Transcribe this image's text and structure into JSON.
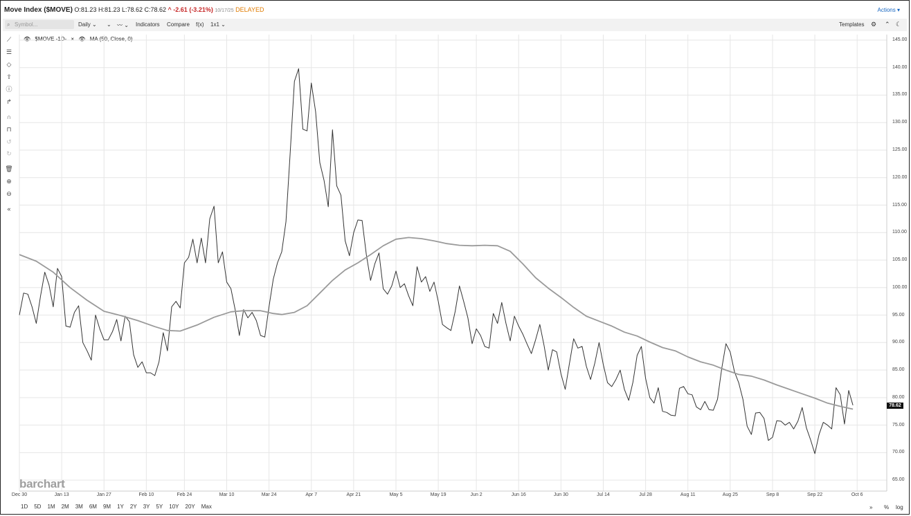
{
  "header": {
    "title": "Move Index ($MOVE)",
    "ohlc": "O:81.23 H:81.23 L:78.62 C:78.62",
    "change": "^ -2.61 (-3.21%)",
    "date": "10/17/25",
    "status": "DELAYED",
    "actions_label": "Actions"
  },
  "toolbar": {
    "symbol_placeholder": "Symbol...",
    "period": "Daily",
    "indicators": "Indicators",
    "compare": "Compare",
    "fx": "f(x)",
    "layout": "1x1",
    "templates": "Templates"
  },
  "legend": {
    "series": "$MOVE -1D-",
    "ma": "MA (50, Close, 0)"
  },
  "watermark": "barchart",
  "last_price_label": "78.62",
  "range_buttons": [
    "1D",
    "5D",
    "1M",
    "2M",
    "3M",
    "6M",
    "9M",
    "1Y",
    "2Y",
    "3Y",
    "5Y",
    "10Y",
    "20Y",
    "Max"
  ],
  "bottom_right": {
    "percent": "%",
    "log": "log"
  },
  "colors": {
    "price": "#333333",
    "ma": "#9a9a9a",
    "negative": "#c62828",
    "delayed": "#e07b00",
    "link": "#1565c0"
  },
  "chart_data": {
    "type": "line",
    "ylim": [
      63,
      146
    ],
    "yticks": [
      "145.00",
      "140.00",
      "135.00",
      "130.00",
      "125.00",
      "120.00",
      "115.00",
      "110.00",
      "105.00",
      "100.00",
      "95.00",
      "90.00",
      "85.00",
      "80.00",
      "75.00",
      "70.00",
      "65.00"
    ],
    "x_range": [
      0,
      205
    ],
    "xticks": [
      {
        "label": "Dec 30",
        "x": 0
      },
      {
        "label": "Jan 13",
        "x": 10
      },
      {
        "label": "Jan 27",
        "x": 20
      },
      {
        "label": "Feb 10",
        "x": 30
      },
      {
        "label": "Feb 24",
        "x": 39
      },
      {
        "label": "Mar 10",
        "x": 49
      },
      {
        "label": "Mar 24",
        "x": 59
      },
      {
        "label": "Apr 7",
        "x": 69
      },
      {
        "label": "Apr 21",
        "x": 79
      },
      {
        "label": "May 5",
        "x": 89
      },
      {
        "label": "May 19",
        "x": 99
      },
      {
        "label": "Jun 2",
        "x": 108
      },
      {
        "label": "Jun 16",
        "x": 118
      },
      {
        "label": "Jun 30",
        "x": 128
      },
      {
        "label": "Jul 14",
        "x": 138
      },
      {
        "label": "Jul 28",
        "x": 148
      },
      {
        "label": "Aug 11",
        "x": 158
      },
      {
        "label": "Aug 25",
        "x": 168
      },
      {
        "label": "Sep 8",
        "x": 178
      },
      {
        "label": "Sep 22",
        "x": 188
      },
      {
        "label": "Oct 6",
        "x": 198
      }
    ],
    "series": [
      {
        "name": "$MOVE -1D-",
        "points": [
          [
            0,
            95
          ],
          [
            1,
            99
          ],
          [
            2,
            98.8
          ],
          [
            3,
            96.5
          ],
          [
            4,
            93.5
          ],
          [
            5,
            98.5
          ],
          [
            6,
            102.8
          ],
          [
            7,
            100.5
          ],
          [
            8,
            96.5
          ],
          [
            9,
            103.5
          ],
          [
            10,
            102
          ],
          [
            11,
            93
          ],
          [
            12,
            92.8
          ],
          [
            13,
            95.5
          ],
          [
            14,
            96.7
          ],
          [
            15,
            90
          ],
          [
            16,
            88.5
          ],
          [
            17,
            86.8
          ],
          [
            18,
            95
          ],
          [
            19,
            92.5
          ],
          [
            20,
            90.5
          ],
          [
            21,
            90.5
          ],
          [
            22,
            92
          ],
          [
            23,
            94.2
          ],
          [
            24,
            90.3
          ],
          [
            25,
            94.8
          ],
          [
            26,
            93.8
          ],
          [
            27,
            87.8
          ],
          [
            28,
            85.5
          ],
          [
            29,
            86.5
          ],
          [
            30,
            84.5
          ],
          [
            31,
            84.5
          ],
          [
            32,
            84
          ],
          [
            33,
            86.5
          ],
          [
            34,
            91.8
          ],
          [
            35,
            88.5
          ],
          [
            36,
            96.5
          ],
          [
            37,
            97.5
          ],
          [
            38,
            96.3
          ],
          [
            39,
            104.5
          ],
          [
            40,
            105.5
          ],
          [
            41,
            108.8
          ],
          [
            42,
            104.5
          ],
          [
            43,
            109
          ],
          [
            44,
            104.5
          ],
          [
            45,
            112.5
          ],
          [
            46,
            114.8
          ],
          [
            47,
            104.5
          ],
          [
            48,
            106.5
          ],
          [
            49,
            101
          ],
          [
            50,
            99.8
          ],
          [
            51,
            96
          ],
          [
            52,
            91.3
          ],
          [
            53,
            96
          ],
          [
            54,
            94.5
          ],
          [
            55,
            95.5
          ],
          [
            56,
            94
          ],
          [
            57,
            91.3
          ],
          [
            58,
            91
          ],
          [
            59,
            96.5
          ],
          [
            60,
            101.5
          ],
          [
            61,
            104.5
          ],
          [
            62,
            106.5
          ],
          [
            63,
            112
          ],
          [
            64,
            124.5
          ],
          [
            65,
            137.5
          ],
          [
            66,
            139.8
          ],
          [
            67,
            128.8
          ],
          [
            68,
            128.5
          ],
          [
            69,
            137.2
          ],
          [
            70,
            132
          ],
          [
            71,
            122.7
          ],
          [
            72,
            119.5
          ],
          [
            73,
            114.7
          ],
          [
            74,
            128.7
          ],
          [
            75,
            118.5
          ],
          [
            76,
            116.8
          ],
          [
            77,
            108.5
          ],
          [
            78,
            105.8
          ],
          [
            79,
            110
          ],
          [
            80,
            112.3
          ],
          [
            81,
            112.2
          ],
          [
            82,
            106
          ],
          [
            83,
            101.3
          ],
          [
            84,
            104.3
          ],
          [
            85,
            106.3
          ],
          [
            86,
            99.8
          ],
          [
            87,
            98.8
          ],
          [
            88,
            100.3
          ],
          [
            89,
            103
          ],
          [
            90,
            100
          ],
          [
            91,
            100.7
          ],
          [
            92,
            98.5
          ],
          [
            93,
            96.7
          ],
          [
            94,
            103.8
          ],
          [
            95,
            101
          ],
          [
            96,
            102
          ],
          [
            97,
            99.3
          ],
          [
            98,
            101
          ],
          [
            99,
            97.5
          ],
          [
            100,
            93.3
          ],
          [
            101,
            92.7
          ],
          [
            102,
            92.2
          ],
          [
            103,
            95.7
          ],
          [
            104,
            100.3
          ],
          [
            105,
            97.5
          ],
          [
            106,
            94.5
          ],
          [
            107,
            89.8
          ],
          [
            108,
            92.5
          ],
          [
            109,
            91.3
          ],
          [
            110,
            89.3
          ],
          [
            111,
            89
          ],
          [
            112,
            95.3
          ],
          [
            113,
            93.5
          ],
          [
            114,
            97.3
          ],
          [
            115,
            93.5
          ],
          [
            116,
            90.3
          ],
          [
            117,
            94.8
          ],
          [
            118,
            93
          ],
          [
            119,
            91.5
          ],
          [
            120,
            89.7
          ],
          [
            121,
            88
          ],
          [
            122,
            90.5
          ],
          [
            123,
            93.3
          ],
          [
            124,
            89.5
          ],
          [
            125,
            85
          ],
          [
            126,
            88.7
          ],
          [
            127,
            88.3
          ],
          [
            128,
            84.3
          ],
          [
            129,
            81.5
          ],
          [
            130,
            86.2
          ],
          [
            131,
            90.7
          ],
          [
            132,
            89
          ],
          [
            133,
            89.3
          ],
          [
            134,
            85.7
          ],
          [
            135,
            83.3
          ],
          [
            136,
            86.3
          ],
          [
            137,
            90
          ],
          [
            138,
            86
          ],
          [
            139,
            82.7
          ],
          [
            140,
            82
          ],
          [
            141,
            83.3
          ],
          [
            142,
            85
          ],
          [
            143,
            81.5
          ],
          [
            144,
            79.5
          ],
          [
            145,
            82.8
          ],
          [
            146,
            87.7
          ],
          [
            147,
            89.3
          ],
          [
            148,
            83.5
          ],
          [
            149,
            80
          ],
          [
            150,
            79
          ],
          [
            151,
            81.8
          ],
          [
            152,
            77.5
          ],
          [
            153,
            77.3
          ],
          [
            154,
            76.8
          ],
          [
            155,
            76.7
          ],
          [
            156,
            81.7
          ],
          [
            157,
            82
          ],
          [
            158,
            80.7
          ],
          [
            159,
            80.5
          ],
          [
            160,
            78.3
          ],
          [
            161,
            77.8
          ],
          [
            162,
            79.3
          ],
          [
            163,
            77.8
          ],
          [
            164,
            77.7
          ],
          [
            165,
            79.7
          ],
          [
            166,
            85.3
          ],
          [
            167,
            89.8
          ],
          [
            168,
            88.3
          ],
          [
            169,
            84.7
          ],
          [
            170,
            82.7
          ],
          [
            171,
            79.7
          ],
          [
            172,
            74.8
          ],
          [
            173,
            73.3
          ],
          [
            174,
            77.2
          ],
          [
            175,
            77.3
          ],
          [
            176,
            76.2
          ],
          [
            177,
            72.2
          ],
          [
            178,
            72.8
          ],
          [
            179,
            75.8
          ],
          [
            180,
            75.7
          ],
          [
            181,
            75
          ],
          [
            182,
            75.5
          ],
          [
            183,
            74.3
          ],
          [
            184,
            75.7
          ],
          [
            185,
            78.2
          ],
          [
            186,
            74.5
          ],
          [
            187,
            72.3
          ],
          [
            188,
            69.8
          ],
          [
            189,
            73.3
          ],
          [
            190,
            75.5
          ],
          [
            191,
            75
          ],
          [
            192,
            74.3
          ],
          [
            193,
            81.8
          ],
          [
            194,
            80.5
          ],
          [
            195,
            75.2
          ],
          [
            196,
            81.3
          ],
          [
            197,
            78.62
          ]
        ]
      },
      {
        "name": "MA (50, Close, 0)",
        "points": [
          [
            0,
            106
          ],
          [
            4,
            104.8
          ],
          [
            8,
            102.8
          ],
          [
            12,
            100
          ],
          [
            16,
            97.7
          ],
          [
            20,
            95.7
          ],
          [
            24,
            94.9
          ],
          [
            28,
            94
          ],
          [
            32,
            92.9
          ],
          [
            35,
            92.2
          ],
          [
            38,
            92.1
          ],
          [
            42,
            93.2
          ],
          [
            46,
            94.6
          ],
          [
            50,
            95.6
          ],
          [
            53,
            95.8
          ],
          [
            57,
            95.8
          ],
          [
            60,
            95.3
          ],
          [
            62,
            95.1
          ],
          [
            65,
            95.5
          ],
          [
            68,
            96.7
          ],
          [
            71,
            99
          ],
          [
            74,
            101.3
          ],
          [
            77,
            103.2
          ],
          [
            80,
            104.5
          ],
          [
            83,
            106
          ],
          [
            86,
            107.6
          ],
          [
            89,
            108.8
          ],
          [
            92,
            109.1
          ],
          [
            95,
            108.9
          ],
          [
            98,
            108.5
          ],
          [
            101,
            108
          ],
          [
            104,
            107.7
          ],
          [
            107,
            107.6
          ],
          [
            110,
            107.7
          ],
          [
            113,
            107.6
          ],
          [
            116,
            106.6
          ],
          [
            119,
            104.3
          ],
          [
            122,
            101.8
          ],
          [
            125,
            99.9
          ],
          [
            128,
            98.2
          ],
          [
            131,
            96.4
          ],
          [
            134,
            94.8
          ],
          [
            137,
            93.9
          ],
          [
            140,
            93
          ],
          [
            143,
            91.9
          ],
          [
            146,
            91.2
          ],
          [
            149,
            90.1
          ],
          [
            152,
            89.1
          ],
          [
            155,
            88.5
          ],
          [
            158,
            87.4
          ],
          [
            161,
            86.5
          ],
          [
            164,
            85.9
          ],
          [
            167,
            85
          ],
          [
            170,
            84.2
          ],
          [
            173,
            83.9
          ],
          [
            176,
            83.2
          ],
          [
            179,
            82.3
          ],
          [
            182,
            81.5
          ],
          [
            185,
            80.7
          ],
          [
            188,
            79.9
          ],
          [
            191,
            79
          ],
          [
            194,
            78.4
          ],
          [
            197,
            77.9
          ]
        ]
      }
    ]
  }
}
